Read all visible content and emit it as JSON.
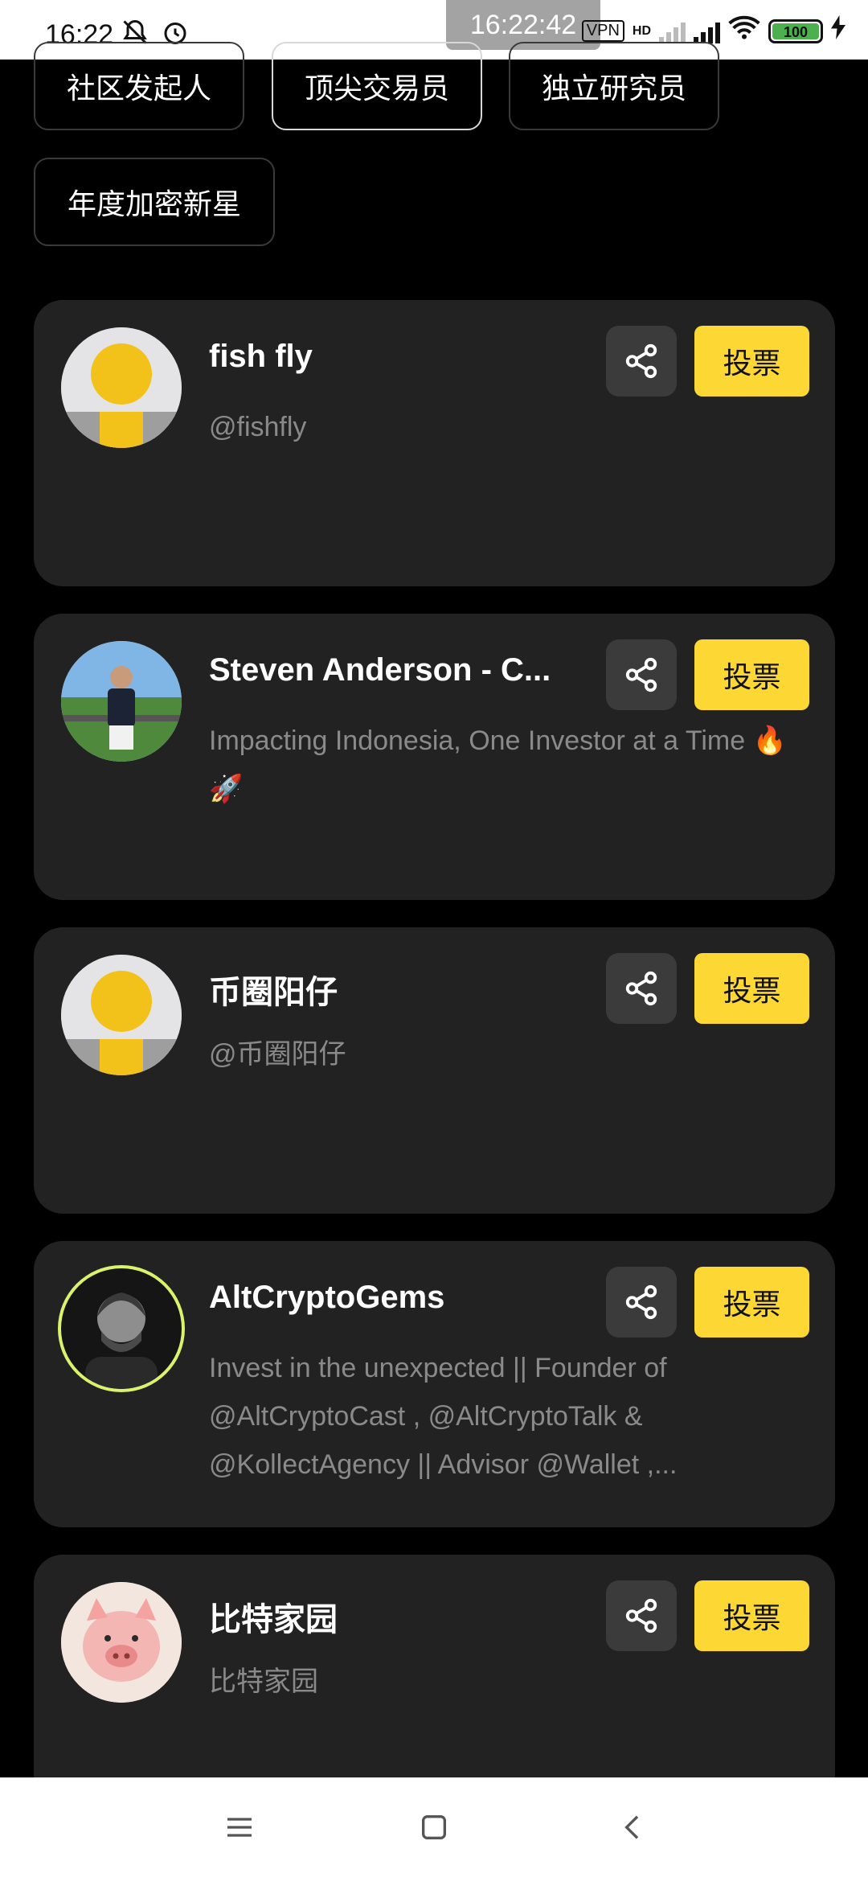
{
  "status_bar": {
    "time": "16:22",
    "overlay_time": "16:22:42",
    "battery": "100",
    "network": "HD",
    "icons": [
      "bell-off-icon",
      "alarm-icon",
      "vpn-icon",
      "signal-icon",
      "wifi-icon",
      "battery-icon",
      "charging-icon"
    ]
  },
  "chips": [
    {
      "label": "社区发起人",
      "active": false
    },
    {
      "label": "顶尖交易员",
      "active": true
    },
    {
      "label": "独立研究员",
      "active": false
    },
    {
      "label": "年度加密新星",
      "active": false
    }
  ],
  "cards": [
    {
      "name": "fish fly",
      "bio": "@fishfly",
      "avatar": "default-avatar-icon",
      "vote_label": "投票"
    },
    {
      "name": "Steven Anderson - C...",
      "bio": "Impacting Indonesia, One Investor at a Time 🔥🚀",
      "avatar": "photo-avatar",
      "vote_label": "投票"
    },
    {
      "name": "币圈阳仔",
      "bio": "@币圈阳仔",
      "avatar": "default-avatar-icon",
      "vote_label": "投票"
    },
    {
      "name": "AltCryptoGems",
      "bio": "Invest in the unexpected || Founder of @AltCryptoCast , @AltCryptoTalk & @KollectAgency || Advisor @Wallet ,...",
      "avatar": "photo-avatar",
      "vote_label": "投票"
    },
    {
      "name": "比特家园",
      "bio": "比特家园",
      "avatar": "pig-avatar",
      "vote_label": "投票"
    }
  ],
  "colors": {
    "background": "#000000",
    "card": "#222222",
    "vote": "#fdd835",
    "share": "#3b3b3b"
  }
}
